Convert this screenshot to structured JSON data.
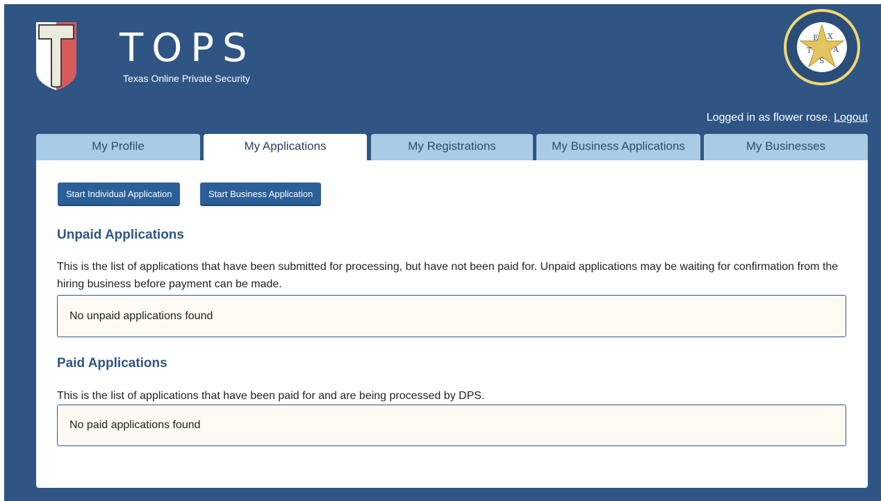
{
  "header": {
    "brand_title": "TOPS",
    "brand_subtitle": "Texas Online Private Security",
    "seal_letters": [
      "E",
      "X",
      "T",
      "A",
      "S"
    ],
    "user_prefix": "Logged in as flower rose.",
    "logout_label": "Logout"
  },
  "tabs": [
    {
      "label": "My Profile"
    },
    {
      "label": "My Applications"
    },
    {
      "label": "My Registrations"
    },
    {
      "label": "My Business Applications"
    },
    {
      "label": "My Businesses"
    }
  ],
  "actions": {
    "start_individual": "Start Individual Application",
    "start_business": "Start Business Application"
  },
  "unpaid": {
    "title": "Unpaid Applications",
    "description": "This is the list of applications that have been submitted for processing, but have not been paid for. Unpaid applications may be waiting for confirmation from the hiring business before payment can be made.",
    "empty_message": "No unpaid applications found"
  },
  "paid": {
    "title": "Paid Applications",
    "description": "This is the list of applications that have been paid for and are being processed by DPS.",
    "empty_message": "No paid applications found"
  },
  "colors": {
    "background": "#2f5584",
    "tab_inactive": "#a9cbe6",
    "button": "#2b5f97",
    "message_box": "#fef9f1"
  }
}
